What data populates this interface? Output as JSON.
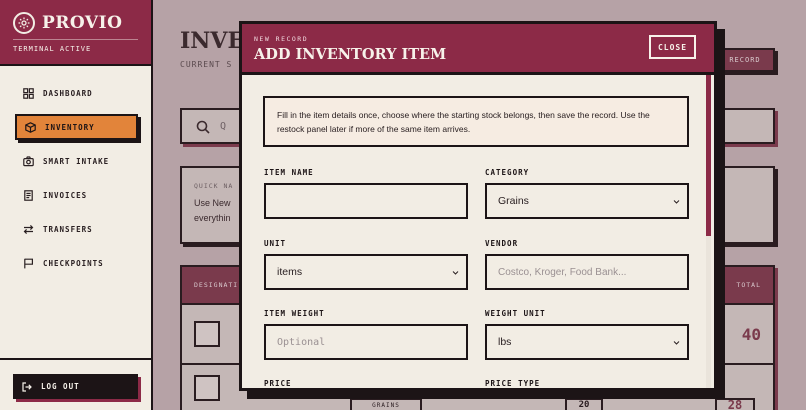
{
  "brand": {
    "name": "PROVIO",
    "status": "TERMINAL ACTIVE"
  },
  "sidebar": {
    "items": [
      {
        "label": "DASHBOARD",
        "icon": "grid-icon",
        "active": false
      },
      {
        "label": "INVENTORY",
        "icon": "box-icon",
        "active": true
      },
      {
        "label": "SMART INTAKE",
        "icon": "camera-icon",
        "active": false
      },
      {
        "label": "INVOICES",
        "icon": "document-icon",
        "active": false
      },
      {
        "label": "TRANSFERS",
        "icon": "arrows-swap-icon",
        "active": false
      },
      {
        "label": "CHECKPOINTS",
        "icon": "flag-icon",
        "active": false
      }
    ],
    "logout_label": "LOG OUT"
  },
  "background": {
    "title": "INVE",
    "subtitle": "CURRENT S",
    "record_button": "RECORD",
    "search_placeholder": "Q",
    "quick_label": "QUICK NA",
    "quick_text_1": "Use New",
    "quick_text_2": "everythin",
    "table_headers": [
      "DESIGNATI",
      "TOTAL"
    ],
    "row1_qty": "40",
    "row2_label": "GRAINS",
    "row2_qty_1": "20",
    "row2_qty_2": "28"
  },
  "modal": {
    "eyebrow": "NEW RECORD",
    "title": "ADD INVENTORY ITEM",
    "close_label": "CLOSE",
    "info_text": "Fill in the item details once, choose where the starting stock belongs, then save the record. Use the restock panel later if more of the same item arrives.",
    "fields": {
      "item_name": {
        "label": "ITEM NAME",
        "value": ""
      },
      "category": {
        "label": "CATEGORY",
        "value": "Grains"
      },
      "unit": {
        "label": "UNIT",
        "value": "items"
      },
      "vendor": {
        "label": "VENDOR",
        "placeholder": "Costco, Kroger, Food Bank..."
      },
      "item_weight": {
        "label": "ITEM WEIGHT",
        "placeholder": "Optional"
      },
      "weight_unit": {
        "label": "WEIGHT UNIT",
        "value": "lbs"
      },
      "price": {
        "label": "PRICE"
      },
      "price_type": {
        "label": "PRICE TYPE"
      }
    }
  },
  "colors": {
    "brand": "#8c2a47",
    "accent": "#e2843a",
    "ink": "#1c1416",
    "paper": "#f2ede4"
  }
}
